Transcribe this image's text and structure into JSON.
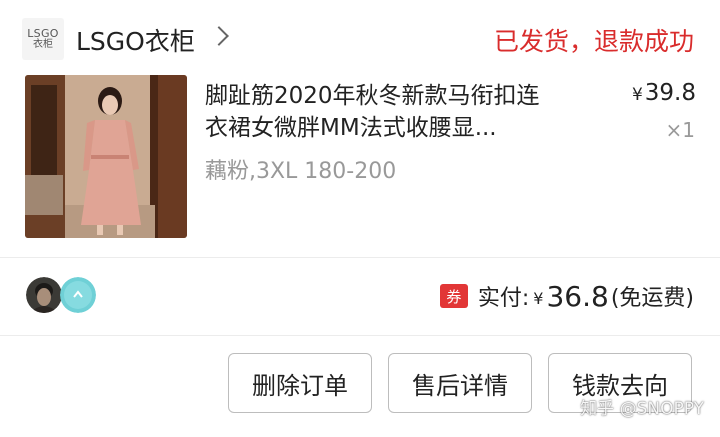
{
  "shop": {
    "logo_line1": "LSGO",
    "logo_line2": "衣柜",
    "name": "LSGO衣柜",
    "status": "已发货，退款成功"
  },
  "product": {
    "title_line1": "脚趾筋2020年秋冬新款马衔扣连",
    "title_line2": "衣裙女微胖MM法式收腰显...",
    "spec": "藕粉,3XL 180-200",
    "price_currency": "¥",
    "price": "39.8",
    "quantity": "×1"
  },
  "payment": {
    "coupon_badge": "券",
    "label": "实付:",
    "currency": "¥",
    "amount": "36.8",
    "shipping_note": "(免运费)"
  },
  "actions": {
    "delete_order": "删除订单",
    "after_sale": "售后详情",
    "money_flow": "钱款去向"
  },
  "watermark": "知乎 @SNOPPY",
  "colors": {
    "status_red": "#d92c2c",
    "coupon_red": "#e23636",
    "muted_gray": "#999999"
  }
}
